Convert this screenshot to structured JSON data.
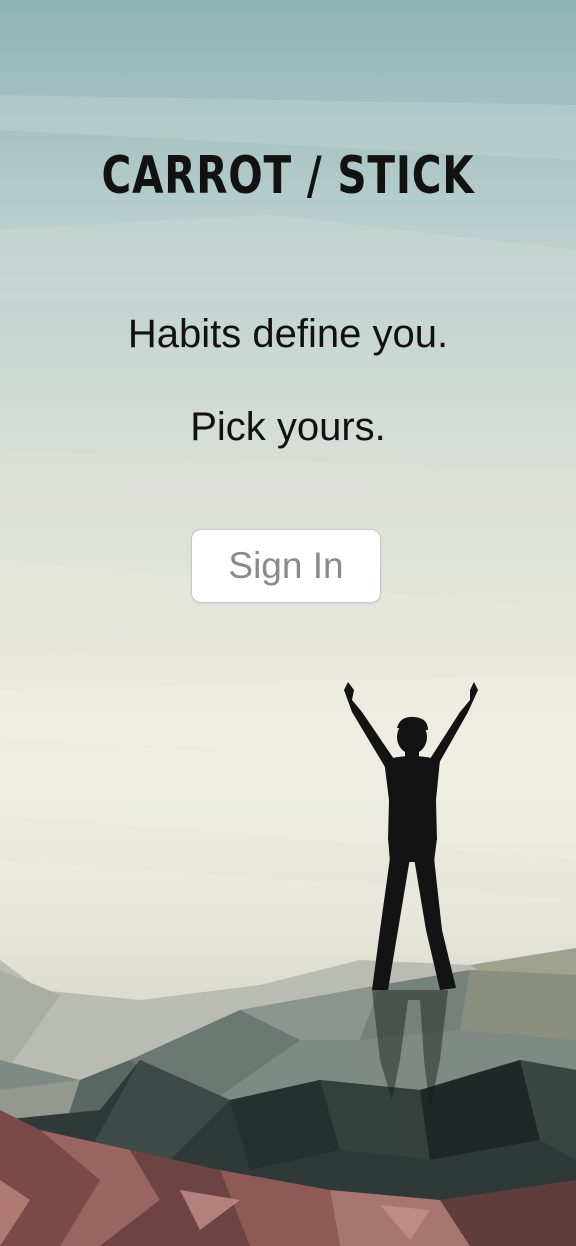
{
  "app": {
    "title": "CARROT / STICK"
  },
  "tagline": {
    "line1": "Habits define you.",
    "line2": "Pick yours."
  },
  "buttons": {
    "sign_in_label": "Sign In"
  },
  "illustration": {
    "description_icon": "person-arms-raised-silhouette-icon",
    "terrain": "low-poly-mountains"
  },
  "colors": {
    "sky_top": "#8fb3b3",
    "sky_mid": "#e7e7dc",
    "silhouette": "#121312",
    "button_text": "#8a8a8a",
    "title_text": "#121212"
  }
}
